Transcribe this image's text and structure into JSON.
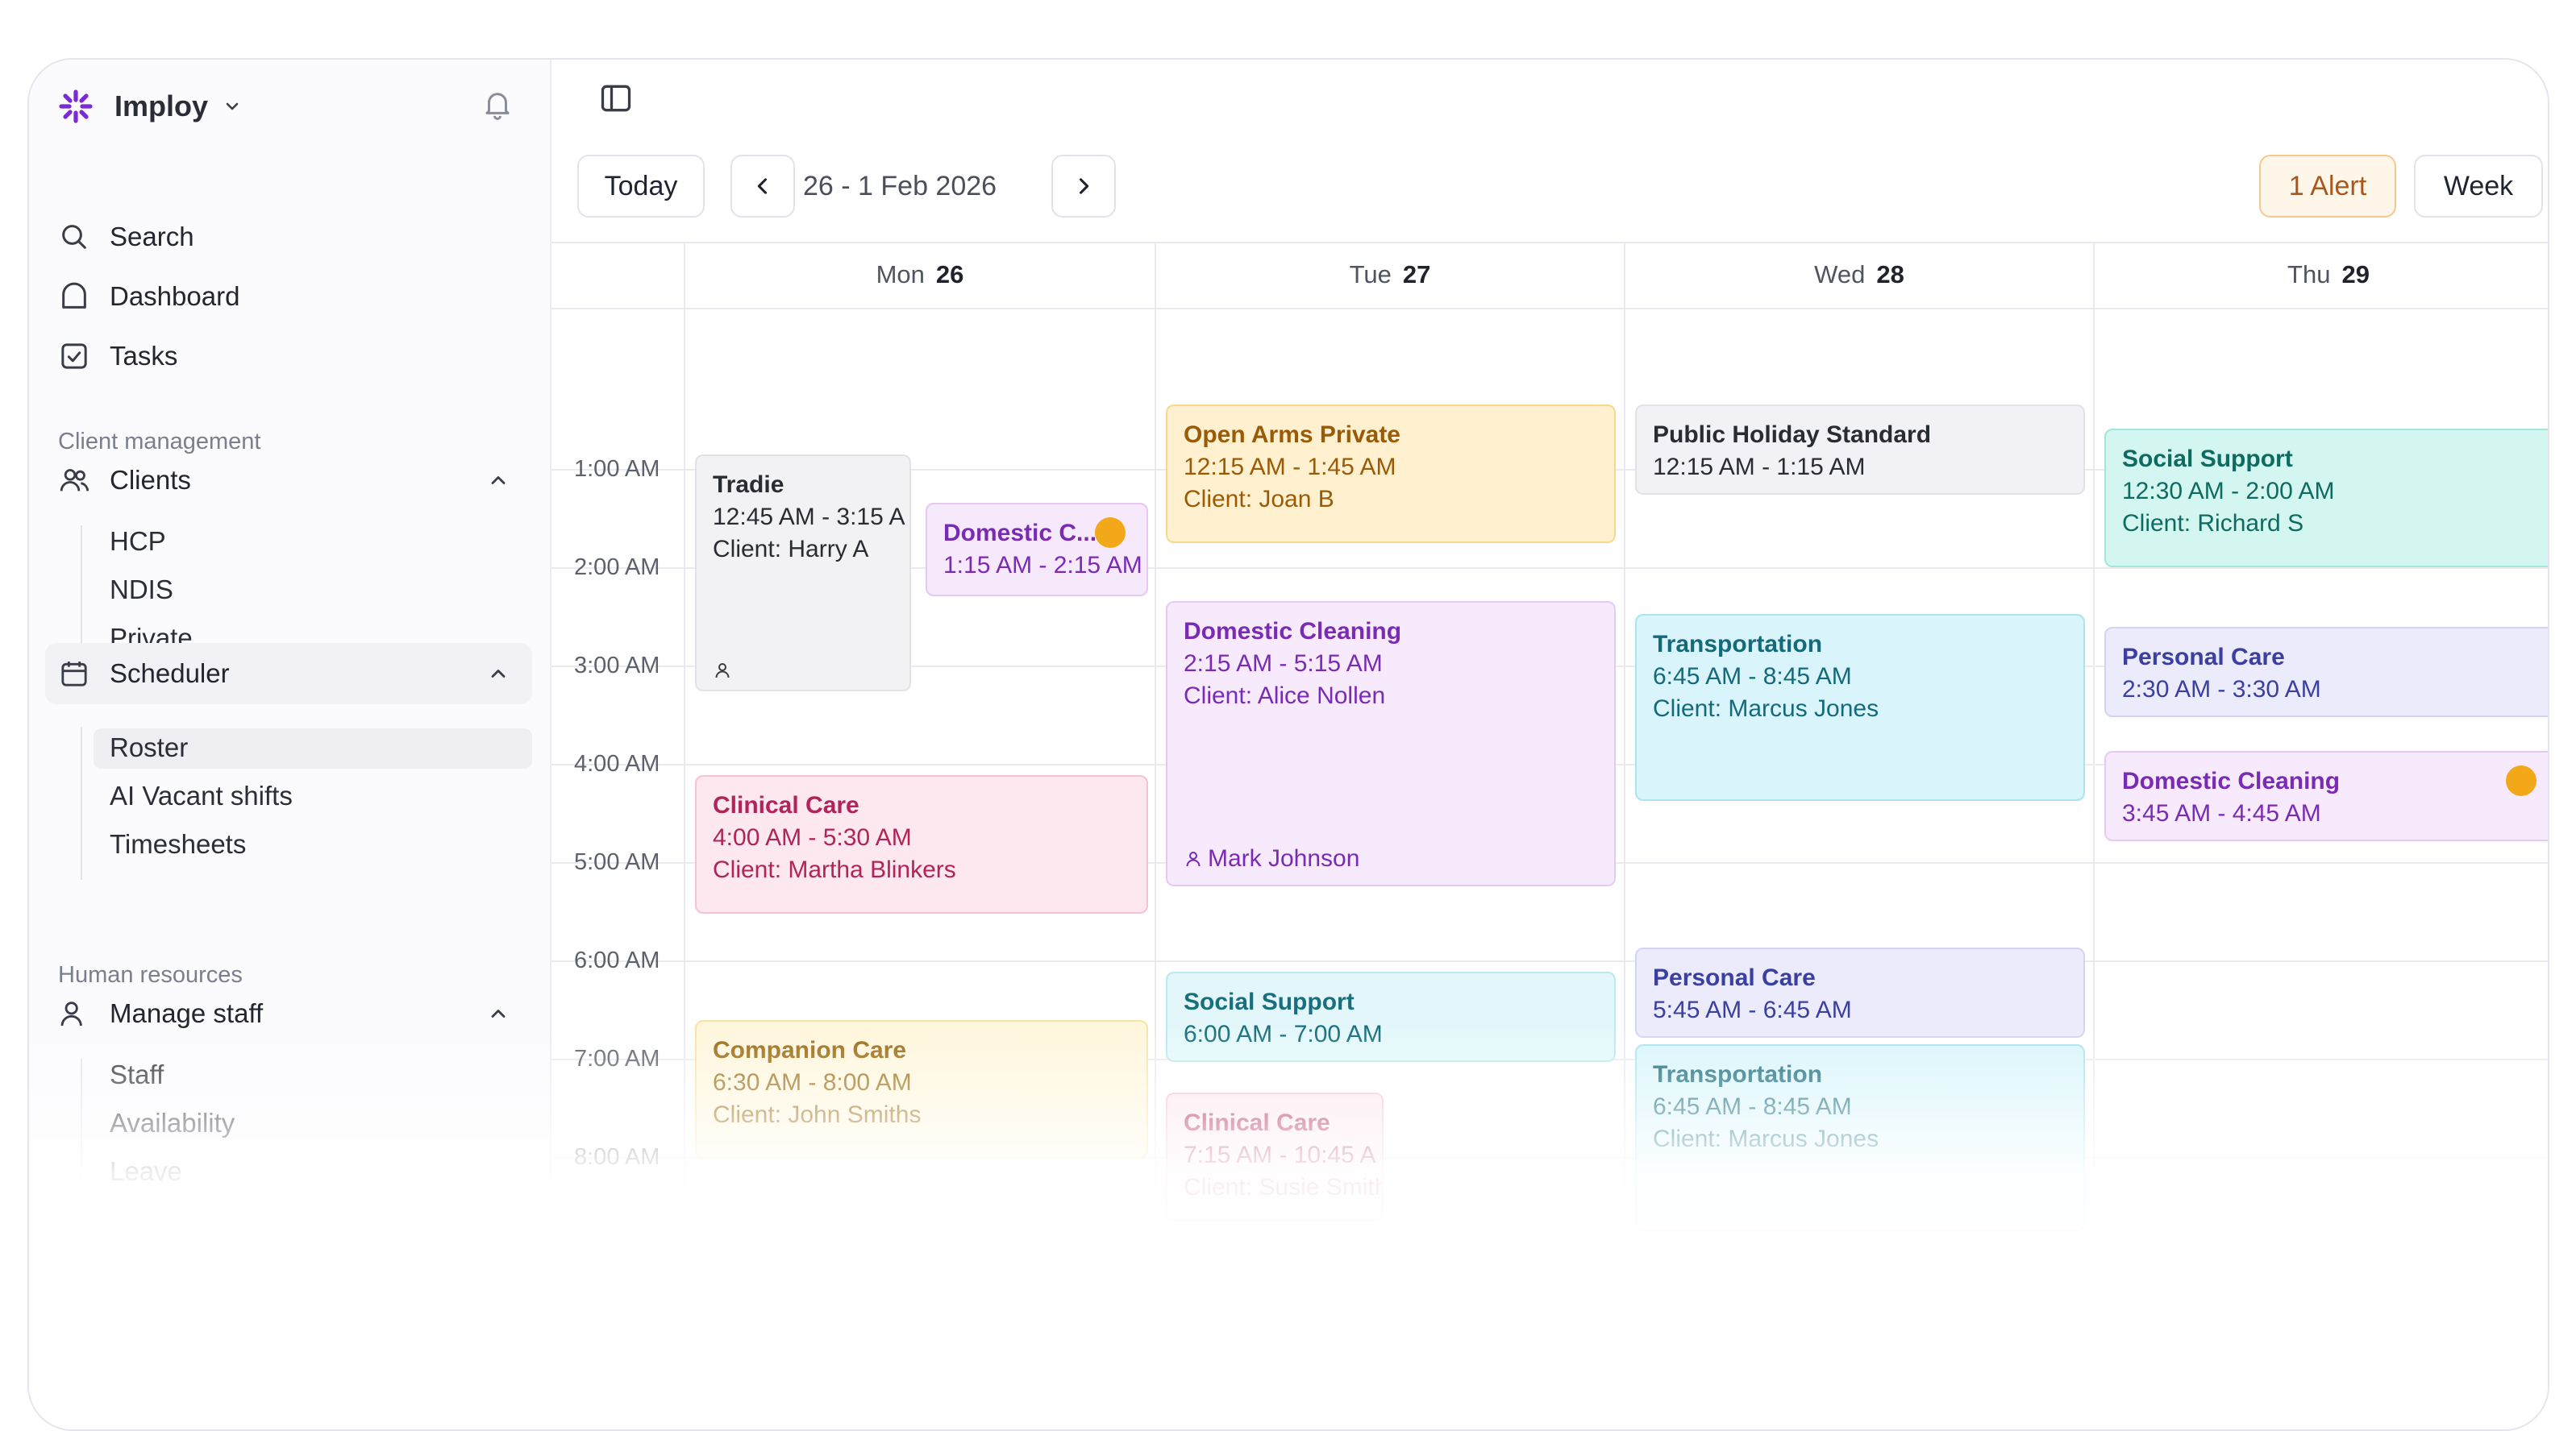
{
  "app": {
    "name": "Imploy"
  },
  "sidebar": {
    "top_items": [
      {
        "label": "Search",
        "icon": "search-icon"
      },
      {
        "label": "Dashboard",
        "icon": "home-icon"
      },
      {
        "label": "Tasks",
        "icon": "checkbox-icon"
      }
    ],
    "client_section_label": "Client management",
    "clients": {
      "label": "Clients",
      "items": [
        "HCP",
        "NDIS",
        "Private"
      ]
    },
    "scheduler": {
      "label": "Scheduler",
      "items": [
        "Roster",
        "AI Vacant shifts",
        "Timesheets"
      ]
    },
    "hr_section_label": "Human resources",
    "manage_staff": {
      "label": "Manage staff",
      "items": [
        "Staff",
        "Availability",
        "Leave"
      ]
    }
  },
  "toolbar": {
    "today": "Today",
    "date_range": "26 - 1 Feb 2026",
    "alert": "1 Alert",
    "view": "Week"
  },
  "days": [
    {
      "name": "Mon",
      "date": "26"
    },
    {
      "name": "Tue",
      "date": "27"
    },
    {
      "name": "Wed",
      "date": "28"
    },
    {
      "name": "Thu",
      "date": "29"
    }
  ],
  "times": [
    "1:00 AM",
    "2:00 AM",
    "3:00 AM",
    "4:00 AM",
    "5:00 AM",
    "6:00 AM",
    "7:00 AM",
    "8:00 AM"
  ],
  "events": {
    "mon_tradie": {
      "title": "Tradie",
      "time": "12:45 AM - 3:15 A",
      "client": "Client: Harry A"
    },
    "mon_domestic": {
      "title": "Domestic C...",
      "time": "1:15 AM - 2:15 AM"
    },
    "mon_clinical": {
      "title": "Clinical Care",
      "time": "4:00 AM - 5:30 AM",
      "client": "Client: Martha Blinkers"
    },
    "mon_companion": {
      "title": "Companion Care",
      "time": "6:30 AM - 8:00 AM",
      "client": "Client: John Smiths"
    },
    "tue_openarms": {
      "title": "Open Arms Private",
      "time": "12:15 AM - 1:45 AM",
      "client": "Client: Joan B"
    },
    "tue_domestic": {
      "title": "Domestic Cleaning",
      "time": "2:15 AM - 5:15 AM",
      "client": "Client: Alice Nollen",
      "staff": "Mark Johnson"
    },
    "tue_social": {
      "title": "Social Support",
      "time": "6:00 AM - 7:00 AM"
    },
    "tue_clinical": {
      "title": "Clinical Care",
      "time": "7:15 AM - 10:45 A",
      "client": "Client: Susie Smith"
    },
    "wed_holiday": {
      "title": "Public Holiday Standard",
      "time": "12:15 AM - 1:15 AM"
    },
    "wed_transport": {
      "title": "Transportation",
      "time": "6:45 AM - 8:45 AM",
      "client": "Client: Marcus Jones"
    },
    "wed_personal": {
      "title": "Personal Care",
      "time": "5:45 AM - 6:45 AM"
    },
    "wed_transport2": {
      "title": "Transportation",
      "time": "6:45 AM - 8:45 AM",
      "client": "Client: Marcus Jones"
    },
    "thu_social": {
      "title": "Social Support",
      "time": "12:30 AM - 2:00 AM",
      "client": "Client: Richard S"
    },
    "thu_personal": {
      "title": "Personal Care",
      "time": "2:30 AM - 3:30 AM"
    },
    "thu_domestic": {
      "title": "Domestic Cleaning",
      "time": "3:45 AM - 4:45 AM"
    }
  },
  "colors": {
    "accent": "#7b2bd6",
    "alert": "#f2a818"
  }
}
